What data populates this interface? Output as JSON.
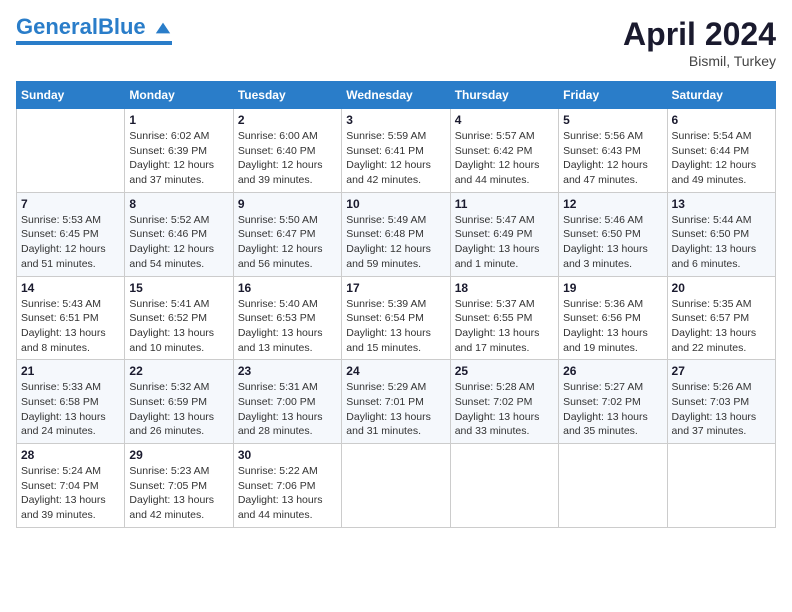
{
  "header": {
    "logo_general": "General",
    "logo_blue": "Blue",
    "month_year": "April 2024",
    "location": "Bismil, Turkey"
  },
  "days_of_week": [
    "Sunday",
    "Monday",
    "Tuesday",
    "Wednesday",
    "Thursday",
    "Friday",
    "Saturday"
  ],
  "weeks": [
    [
      {
        "day": "",
        "info": ""
      },
      {
        "day": "1",
        "info": "Sunrise: 6:02 AM\nSunset: 6:39 PM\nDaylight: 12 hours\nand 37 minutes."
      },
      {
        "day": "2",
        "info": "Sunrise: 6:00 AM\nSunset: 6:40 PM\nDaylight: 12 hours\nand 39 minutes."
      },
      {
        "day": "3",
        "info": "Sunrise: 5:59 AM\nSunset: 6:41 PM\nDaylight: 12 hours\nand 42 minutes."
      },
      {
        "day": "4",
        "info": "Sunrise: 5:57 AM\nSunset: 6:42 PM\nDaylight: 12 hours\nand 44 minutes."
      },
      {
        "day": "5",
        "info": "Sunrise: 5:56 AM\nSunset: 6:43 PM\nDaylight: 12 hours\nand 47 minutes."
      },
      {
        "day": "6",
        "info": "Sunrise: 5:54 AM\nSunset: 6:44 PM\nDaylight: 12 hours\nand 49 minutes."
      }
    ],
    [
      {
        "day": "7",
        "info": "Sunrise: 5:53 AM\nSunset: 6:45 PM\nDaylight: 12 hours\nand 51 minutes."
      },
      {
        "day": "8",
        "info": "Sunrise: 5:52 AM\nSunset: 6:46 PM\nDaylight: 12 hours\nand 54 minutes."
      },
      {
        "day": "9",
        "info": "Sunrise: 5:50 AM\nSunset: 6:47 PM\nDaylight: 12 hours\nand 56 minutes."
      },
      {
        "day": "10",
        "info": "Sunrise: 5:49 AM\nSunset: 6:48 PM\nDaylight: 12 hours\nand 59 minutes."
      },
      {
        "day": "11",
        "info": "Sunrise: 5:47 AM\nSunset: 6:49 PM\nDaylight: 13 hours\nand 1 minute."
      },
      {
        "day": "12",
        "info": "Sunrise: 5:46 AM\nSunset: 6:50 PM\nDaylight: 13 hours\nand 3 minutes."
      },
      {
        "day": "13",
        "info": "Sunrise: 5:44 AM\nSunset: 6:50 PM\nDaylight: 13 hours\nand 6 minutes."
      }
    ],
    [
      {
        "day": "14",
        "info": "Sunrise: 5:43 AM\nSunset: 6:51 PM\nDaylight: 13 hours\nand 8 minutes."
      },
      {
        "day": "15",
        "info": "Sunrise: 5:41 AM\nSunset: 6:52 PM\nDaylight: 13 hours\nand 10 minutes."
      },
      {
        "day": "16",
        "info": "Sunrise: 5:40 AM\nSunset: 6:53 PM\nDaylight: 13 hours\nand 13 minutes."
      },
      {
        "day": "17",
        "info": "Sunrise: 5:39 AM\nSunset: 6:54 PM\nDaylight: 13 hours\nand 15 minutes."
      },
      {
        "day": "18",
        "info": "Sunrise: 5:37 AM\nSunset: 6:55 PM\nDaylight: 13 hours\nand 17 minutes."
      },
      {
        "day": "19",
        "info": "Sunrise: 5:36 AM\nSunset: 6:56 PM\nDaylight: 13 hours\nand 19 minutes."
      },
      {
        "day": "20",
        "info": "Sunrise: 5:35 AM\nSunset: 6:57 PM\nDaylight: 13 hours\nand 22 minutes."
      }
    ],
    [
      {
        "day": "21",
        "info": "Sunrise: 5:33 AM\nSunset: 6:58 PM\nDaylight: 13 hours\nand 24 minutes."
      },
      {
        "day": "22",
        "info": "Sunrise: 5:32 AM\nSunset: 6:59 PM\nDaylight: 13 hours\nand 26 minutes."
      },
      {
        "day": "23",
        "info": "Sunrise: 5:31 AM\nSunset: 7:00 PM\nDaylight: 13 hours\nand 28 minutes."
      },
      {
        "day": "24",
        "info": "Sunrise: 5:29 AM\nSunset: 7:01 PM\nDaylight: 13 hours\nand 31 minutes."
      },
      {
        "day": "25",
        "info": "Sunrise: 5:28 AM\nSunset: 7:02 PM\nDaylight: 13 hours\nand 33 minutes."
      },
      {
        "day": "26",
        "info": "Sunrise: 5:27 AM\nSunset: 7:02 PM\nDaylight: 13 hours\nand 35 minutes."
      },
      {
        "day": "27",
        "info": "Sunrise: 5:26 AM\nSunset: 7:03 PM\nDaylight: 13 hours\nand 37 minutes."
      }
    ],
    [
      {
        "day": "28",
        "info": "Sunrise: 5:24 AM\nSunset: 7:04 PM\nDaylight: 13 hours\nand 39 minutes."
      },
      {
        "day": "29",
        "info": "Sunrise: 5:23 AM\nSunset: 7:05 PM\nDaylight: 13 hours\nand 42 minutes."
      },
      {
        "day": "30",
        "info": "Sunrise: 5:22 AM\nSunset: 7:06 PM\nDaylight: 13 hours\nand 44 minutes."
      },
      {
        "day": "",
        "info": ""
      },
      {
        "day": "",
        "info": ""
      },
      {
        "day": "",
        "info": ""
      },
      {
        "day": "",
        "info": ""
      }
    ]
  ]
}
